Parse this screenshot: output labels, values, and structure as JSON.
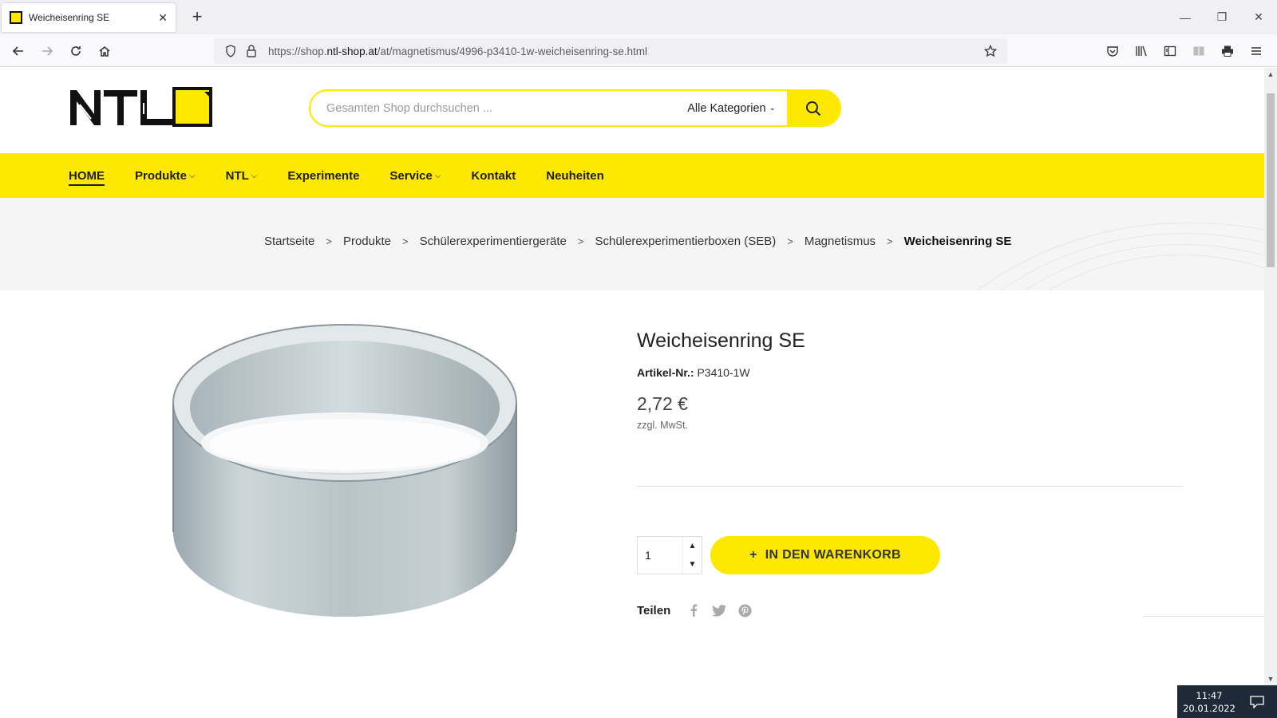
{
  "browser": {
    "tab_title": "Weicheisenring SE",
    "new_tab": "+",
    "url_prefix": "https://shop.",
    "url_domain": "ntl-shop.at",
    "url_path": "/at/magnetismus/4996-p3410-1w-weicheisenring-se.html"
  },
  "header": {
    "logo_text": "NTL",
    "search_placeholder": "Gesamten Shop durchsuchen ...",
    "category_select": "Alle Kategorien"
  },
  "nav": {
    "items": [
      {
        "label": "HOME"
      },
      {
        "label": "Produkte"
      },
      {
        "label": "NTL"
      },
      {
        "label": "Experimente"
      },
      {
        "label": "Service"
      },
      {
        "label": "Kontakt"
      },
      {
        "label": "Neuheiten"
      }
    ]
  },
  "breadcrumb": {
    "items": [
      "Startseite",
      "Produkte",
      "Schülerexperimentiergeräte",
      "Schülerexperimentierboxen (SEB)",
      "Magnetismus"
    ],
    "current": "Weicheisenring SE"
  },
  "product": {
    "title": "Weicheisenring SE",
    "sku_label": "Artikel-Nr.:",
    "sku": "P3410-1W",
    "price": "2,72 €",
    "tax_note": "zzgl. MwSt.",
    "quantity": "1",
    "add_to_cart": "IN DEN WARENKORB",
    "add_symbol": "+",
    "share_label": "Teilen"
  },
  "taskbar": {
    "time": "11:47",
    "date": "20.01.2022"
  },
  "colors": {
    "brand_yellow": "#ffe800",
    "text_dark": "#222222"
  }
}
